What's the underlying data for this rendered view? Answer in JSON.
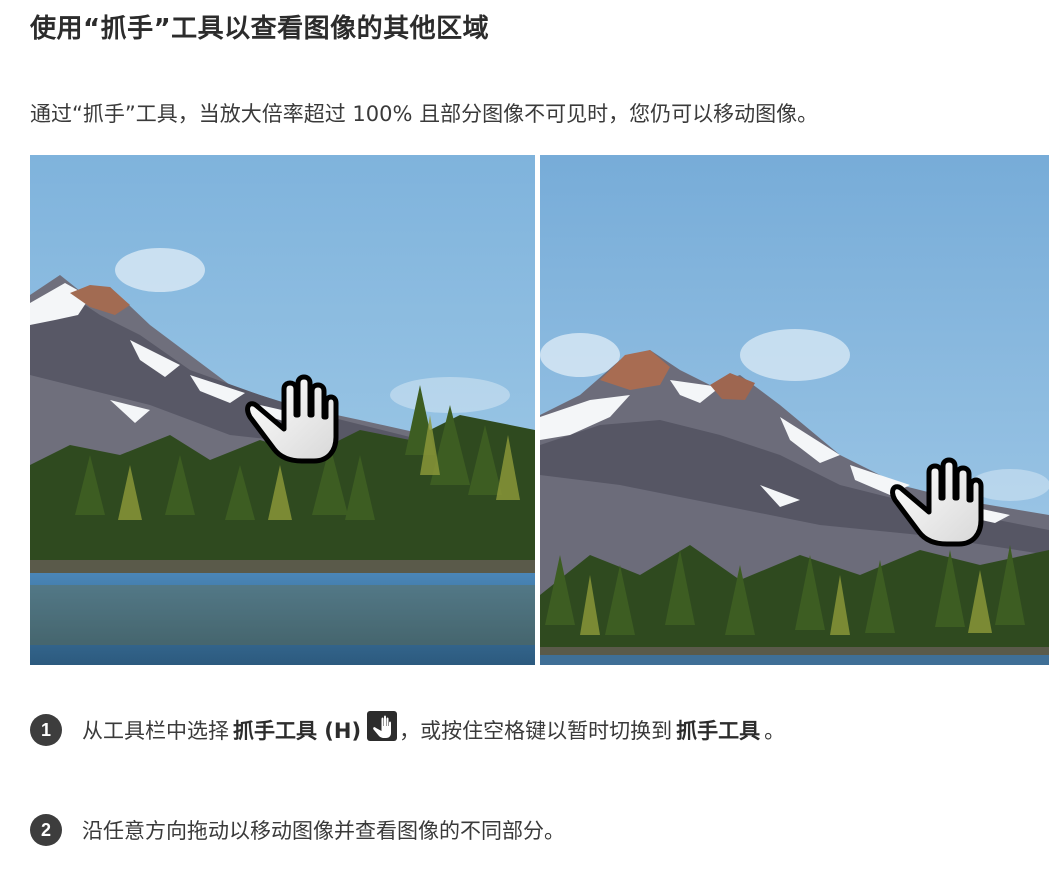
{
  "heading": "使用“抓手”工具以查看图像的其他区域",
  "intro": "通过“抓手”工具，当放大倍率超过 100% 且部分图像不可见时，您仍可以移动图像。",
  "images": {
    "left_icon": "hand-cursor-icon",
    "right_icon": "hand-cursor-icon"
  },
  "steps": [
    {
      "number": "1",
      "part1": "从工具栏中选择",
      "bold1": "抓手工具 (H)",
      "icon": "hand-tool-icon",
      "part2": "，或按住空格键以暂时切换到",
      "bold2": "抓手工具",
      "part3": "。"
    },
    {
      "number": "2",
      "text": "沿任意方向拖动以移动图像并查看图像的不同部分。"
    }
  ]
}
